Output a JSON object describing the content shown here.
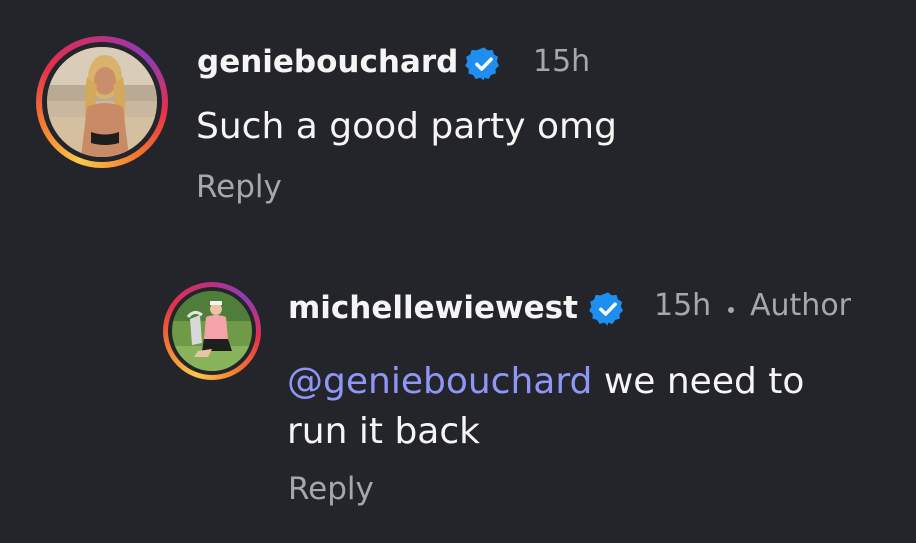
{
  "comments": [
    {
      "username": "geniebouchard",
      "verified_icon": "verified-badge-icon",
      "time": "15h",
      "text": "Such a good party omg",
      "reply_label": "Reply"
    },
    {
      "username": "michellewiewest",
      "verified_icon": "verified-badge-icon",
      "time": "15h",
      "author_label": "Author",
      "mention": "@geniebouchard",
      "text": "we need to",
      "text_line2": "run it back",
      "reply_label": "Reply"
    }
  ],
  "colors": {
    "background": "#24252b",
    "primary_text": "#f5f5f5",
    "secondary_text": "#a6a7ad",
    "mention": "#8f96f6",
    "verified": "#1f8ef1"
  }
}
